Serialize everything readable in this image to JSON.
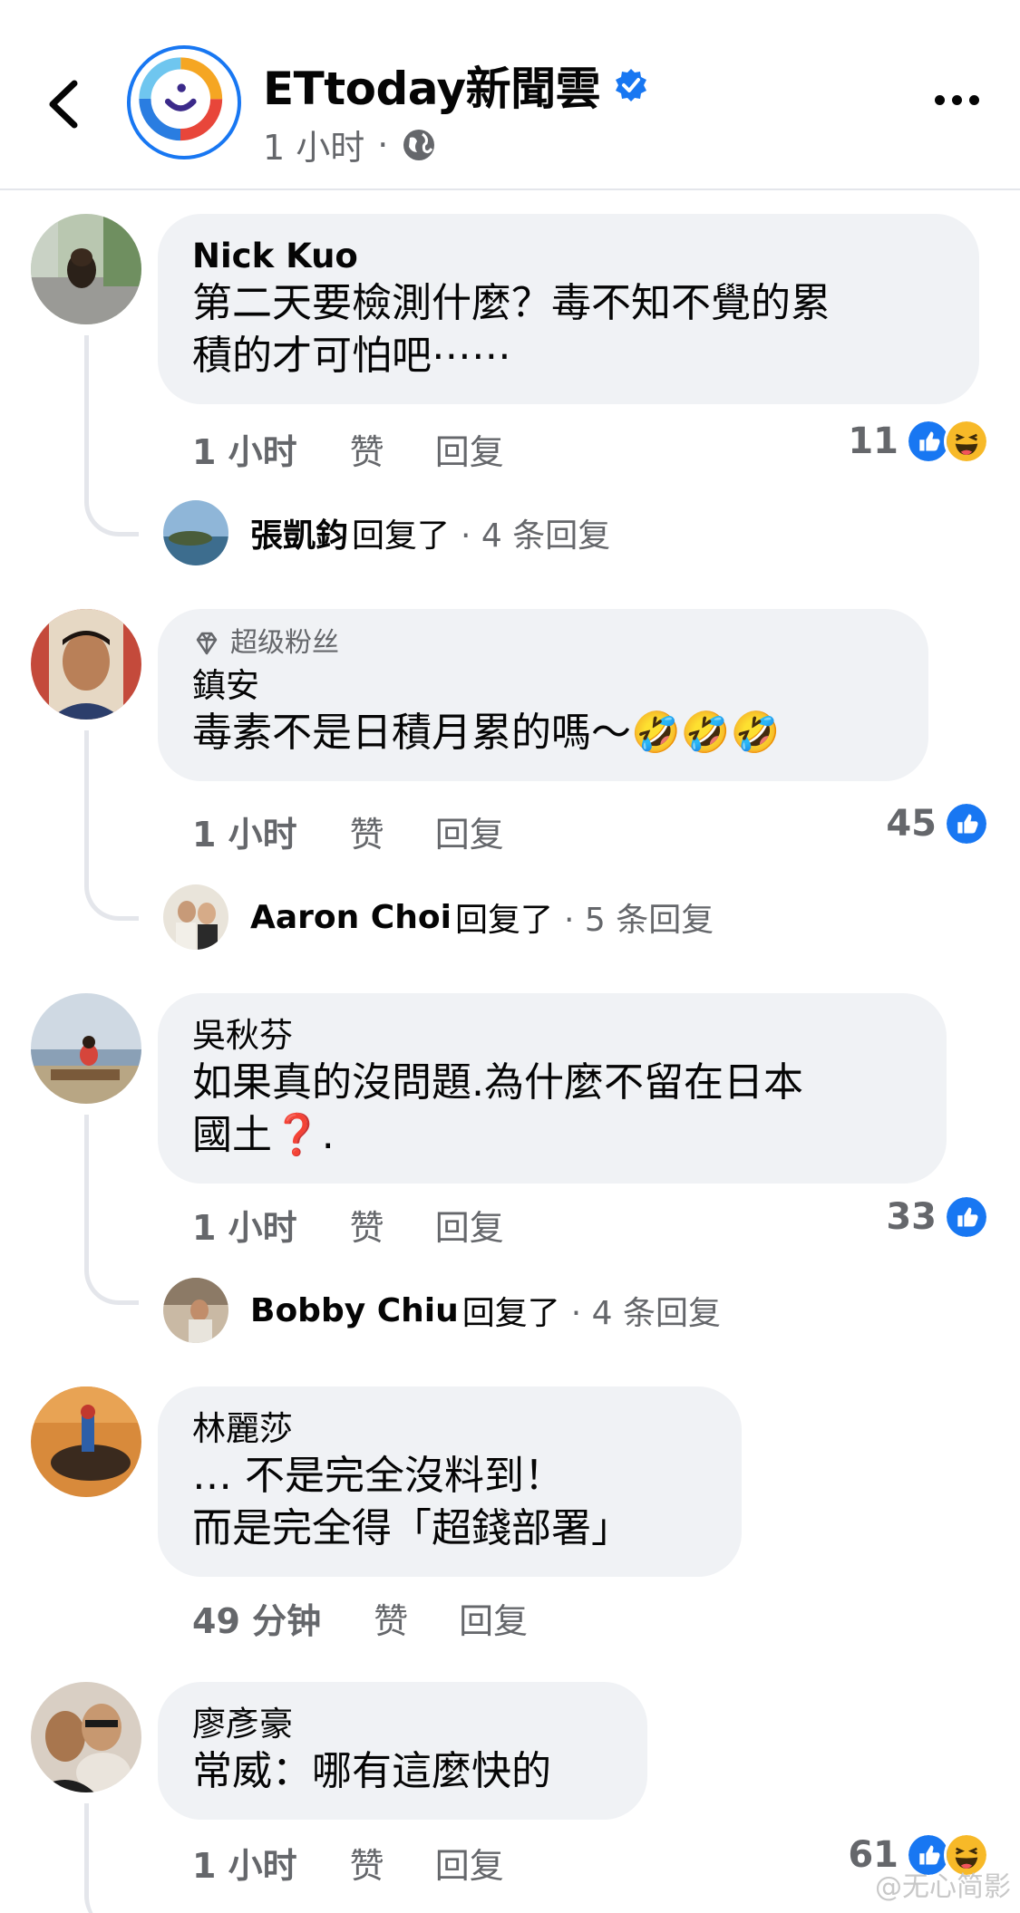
{
  "header": {
    "page_name": "ETtoday新聞雲",
    "time": "1 小时",
    "dot": "·"
  },
  "colors": {
    "brand": "#1877f2",
    "bubble": "#f0f2f5",
    "meta": "#65676b"
  },
  "comments": [
    {
      "author": "Nick Kuo",
      "text": "第二天要檢測什麼？毒不知不覺的累\n積的才可怕吧⋯⋯",
      "time": "1 小时",
      "like_label": "赞",
      "reply_label": "回复",
      "reaction_count": "11",
      "reactions": [
        "like-icon",
        "haha-icon"
      ],
      "reply_summary": {
        "name": "張凱鈞",
        "verb": "回复了",
        "count": "· 4 条回复"
      }
    },
    {
      "badge": "超级粉丝",
      "author": "鎮安",
      "text": "毒素不是日積月累的嗎～🤣🤣🤣",
      "time": "1 小时",
      "like_label": "赞",
      "reply_label": "回复",
      "reaction_count": "45",
      "reactions": [
        "like-icon"
      ],
      "reply_summary": {
        "name": "Aaron Choi",
        "verb": "回复了",
        "count": "· 5 条回复"
      }
    },
    {
      "author": "吳秋芬",
      "text": "如果真的沒問題.為什麼不留在日本\n國土❓.",
      "time": "1 小时",
      "like_label": "赞",
      "reply_label": "回复",
      "reaction_count": "33",
      "reactions": [
        "like-icon"
      ],
      "reply_summary": {
        "name": "Bobby Chiu",
        "verb": "回复了",
        "count": "· 4 条回复"
      }
    },
    {
      "author": "林麗莎",
      "text": "… 不是完全沒料到！\n而是完全得「超錢部署」",
      "time": "49 分钟",
      "like_label": "赞",
      "reply_label": "回复"
    },
    {
      "author": "廖彥豪",
      "text": "常威：哪有這麼快的",
      "time": "1 小时",
      "like_label": "赞",
      "reply_label": "回复",
      "reaction_count": "61",
      "reactions": [
        "like-icon",
        "haha-icon"
      ]
    }
  ],
  "watermark": "@无心简影"
}
